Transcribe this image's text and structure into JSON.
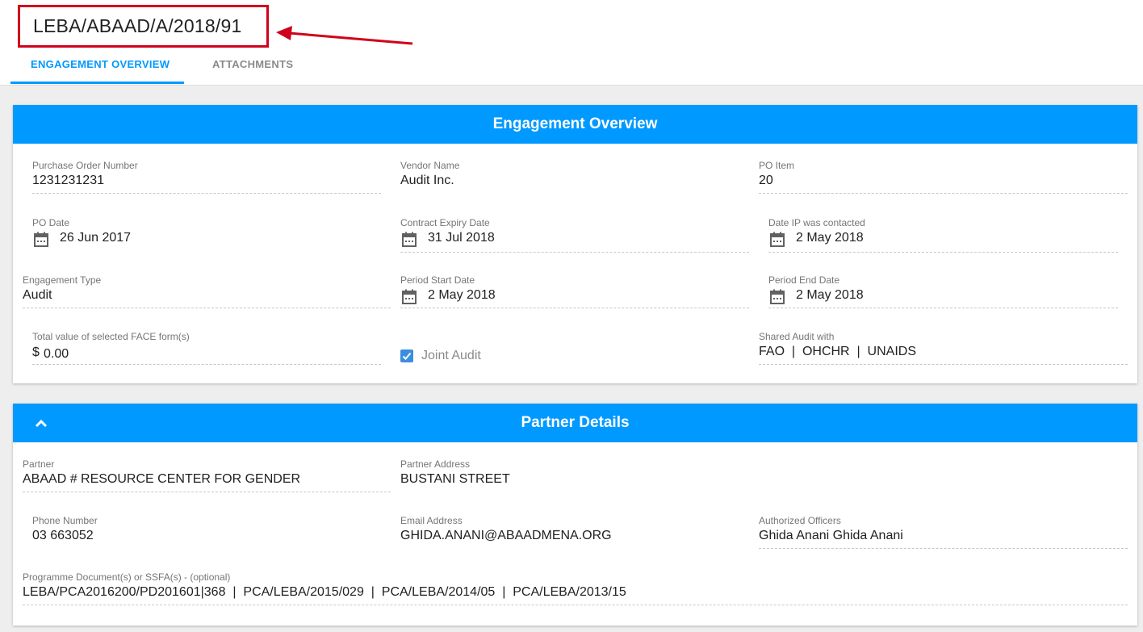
{
  "header": {
    "engagement_id": "LEBA/ABAAD/A/2018/91",
    "tabs": [
      {
        "label": "ENGAGEMENT OVERVIEW"
      },
      {
        "label": "ATTACHMENTS"
      }
    ]
  },
  "engagement_overview": {
    "title": "Engagement Overview",
    "purchase_order_number": {
      "label": "Purchase Order Number",
      "value": "1231231231"
    },
    "vendor_name": {
      "label": "Vendor Name",
      "value": "Audit Inc."
    },
    "po_item": {
      "label": "PO Item",
      "value": "20"
    },
    "po_date": {
      "label": "PO Date",
      "value": "26 Jun 2017"
    },
    "contract_expiry_date": {
      "label": "Contract Expiry Date",
      "value": "31 Jul 2018"
    },
    "date_ip_contacted": {
      "label": "Date IP was contacted",
      "value": "2 May 2018"
    },
    "engagement_type": {
      "label": "Engagement Type",
      "value": "Audit"
    },
    "period_start_date": {
      "label": "Period Start Date",
      "value": "2 May 2018"
    },
    "period_end_date": {
      "label": "Period End Date",
      "value": "2 May 2018"
    },
    "total_face_value": {
      "label": "Total value of selected FACE form(s)",
      "currency": "$",
      "value": "0.00"
    },
    "joint_audit": {
      "label": "Joint Audit",
      "checked": true
    },
    "shared_audit": {
      "label": "Shared Audit with",
      "value": "FAO  |  OHCHR  |  UNAIDS"
    }
  },
  "partner_details": {
    "title": "Partner Details",
    "partner": {
      "label": "Partner",
      "value": "ABAAD # RESOURCE CENTER FOR GENDER"
    },
    "partner_address": {
      "label": "Partner Address",
      "value": "BUSTANI STREET"
    },
    "phone_number": {
      "label": "Phone Number",
      "value": "03 663052"
    },
    "email_address": {
      "label": "Email Address",
      "value": "GHIDA.ANANI@ABAADMENA.ORG"
    },
    "authorized_officers": {
      "label": "Authorized Officers",
      "value": "Ghida Anani Ghida Anani"
    },
    "programme_documents": {
      "label": "Programme Document(s) or SSFA(s) - (optional)",
      "value": "LEBA/PCA2016200/PD201601|368  |  PCA/LEBA/2015/029  |  PCA/LEBA/2014/05  |  PCA/LEBA/2013/15"
    }
  },
  "colors": {
    "accent": "#0099ff",
    "highlight": "#d0021b",
    "checkbox": "#3b8ede"
  },
  "icons": [
    "calendar-icon",
    "chevron-up-icon",
    "check-icon",
    "arrow-icon"
  ]
}
